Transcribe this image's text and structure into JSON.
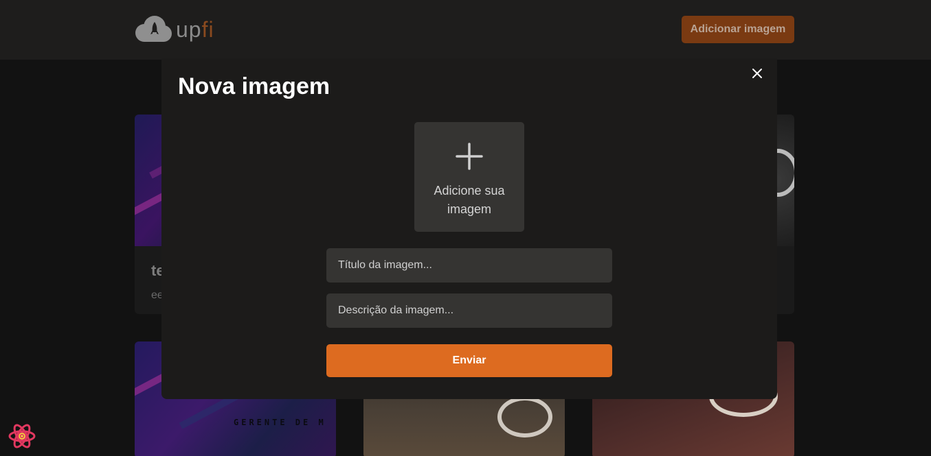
{
  "header": {
    "logo_text_up": "up",
    "logo_text_fi": "fi",
    "add_image_label": "Adicionar imagem"
  },
  "background_cards": {
    "top_left_title": "te",
    "top_left_desc": "ee",
    "bottom_left_text": "GERENTE DE M"
  },
  "modal": {
    "title": "Nova imagem",
    "upload_label": "Adicione sua imagem",
    "title_placeholder": "Título da imagem...",
    "description_placeholder": "Descrição da imagem...",
    "submit_label": "Enviar"
  },
  "colors": {
    "accent": "#dd6b20",
    "header_bg": "#1e1d1c",
    "modal_bg": "#1c1b1a",
    "field_bg": "#353432"
  },
  "icons": {
    "logo": "cloud-rocket-icon",
    "close": "close-icon",
    "upload": "plus-icon",
    "devtools": "react-icon"
  }
}
